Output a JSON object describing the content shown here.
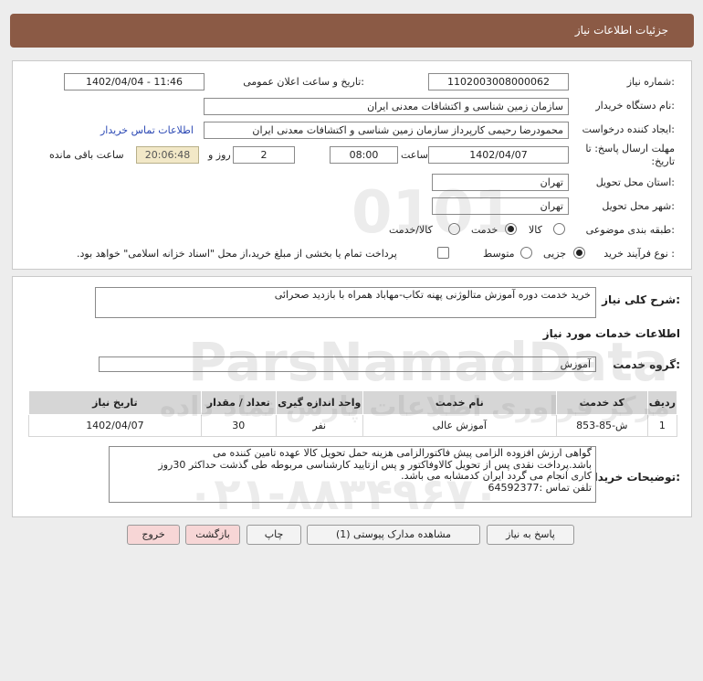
{
  "header": {
    "title": "جزئیات اطلاعات نیاز"
  },
  "fields": {
    "need_number_label": "شماره نیاز:",
    "need_number": "1102003008000062",
    "announce_label": "تاریخ و ساعت اعلان عمومی:",
    "announce_value": "1402/04/04 - 11:46",
    "buyer_org_label": "نام دستگاه خریدار:",
    "buyer_org": "سازمان زمین شناسی و اکتشافات معدنی ایران",
    "requester_label": "ایجاد کننده درخواست:",
    "requester": "محمودرضا رحیمی کارپرداز سازمان زمین شناسی و اکتشافات معدنی ایران",
    "buyer_contact_link": "اطلاعات تماس خریدار",
    "deadline_label": "مهلت ارسال پاسخ: تا تاریخ:",
    "deadline_date": "1402/04/07",
    "time_label": "ساعت",
    "deadline_time": "08:00",
    "days_value": "2",
    "days_label": "روز و",
    "remaining_time": "20:06:48",
    "remaining_label": "ساعت باقی مانده",
    "province_label": "استان محل تحویل:",
    "province": "تهران",
    "city_label": "شهر محل تحویل:",
    "city": "تهران",
    "category_label": "طبقه بندی موضوعی:",
    "category_options": [
      "کالا",
      "خدمت",
      "کالا/خدمت"
    ],
    "category_selected": "خدمت",
    "purchase_type_label": "نوع فرآیند خرید :",
    "purchase_options": [
      "جزیی",
      "متوسط"
    ],
    "purchase_selected": "جزیی",
    "payment_note": "پرداخت تمام یا بخشی از مبلغ خرید،از محل \"اسناد خزانه اسلامی\" خواهد بود."
  },
  "details": {
    "general_desc_label": "شرح کلی نیاز:",
    "general_desc": "خرید خدمت دوره آموزش متالوژنی پهنه تکاب-مهاباد همراه با بازدید صحرائی",
    "services_heading": "اطلاعات خدمات مورد نیاز",
    "service_group_label": "گروه خدمت:",
    "service_group": "آموزش",
    "table": {
      "headers": [
        "ردیف",
        "کد خدمت",
        "نام خدمت",
        "واحد اندازه گیری",
        "تعداد / مقدار",
        "تاریخ نیاز"
      ],
      "rows": [
        [
          "1",
          "ش-85-853",
          "آموزش عالی",
          "نفر",
          "30",
          "1402/04/07"
        ]
      ]
    },
    "buyer_notes_label": "توضیحات خریدار:",
    "buyer_notes_lines": [
      "گواهی ارزش افزوده الزامی پیش فاکتورالزامی هزینه حمل تحویل کالا عهده تامین کننده می",
      "باشد.پرداخت نقدی پس از تحویل کالاوفاکتور و پس ازتایید کارشناسی مربوطه طی گذشت حداکثر 30روز",
      "کاری انجام می گردد ایران کدمشابه می باشد.",
      "تلفن تماس :64592377"
    ]
  },
  "buttons": {
    "reply": "پاسخ به نیاز",
    "attachments": "مشاهده مدارک پیوستی (1)",
    "print": "چاپ",
    "back": "بازگشت",
    "exit": "خروج"
  },
  "watermark": {
    "brand": "ParsNamadData",
    "digits": "0101",
    "tagline": "مرکز فراوری اطلاعات پارس نماد داده",
    "phone": "۰۲۱-۸۸۳۴۹۶۷۰"
  }
}
